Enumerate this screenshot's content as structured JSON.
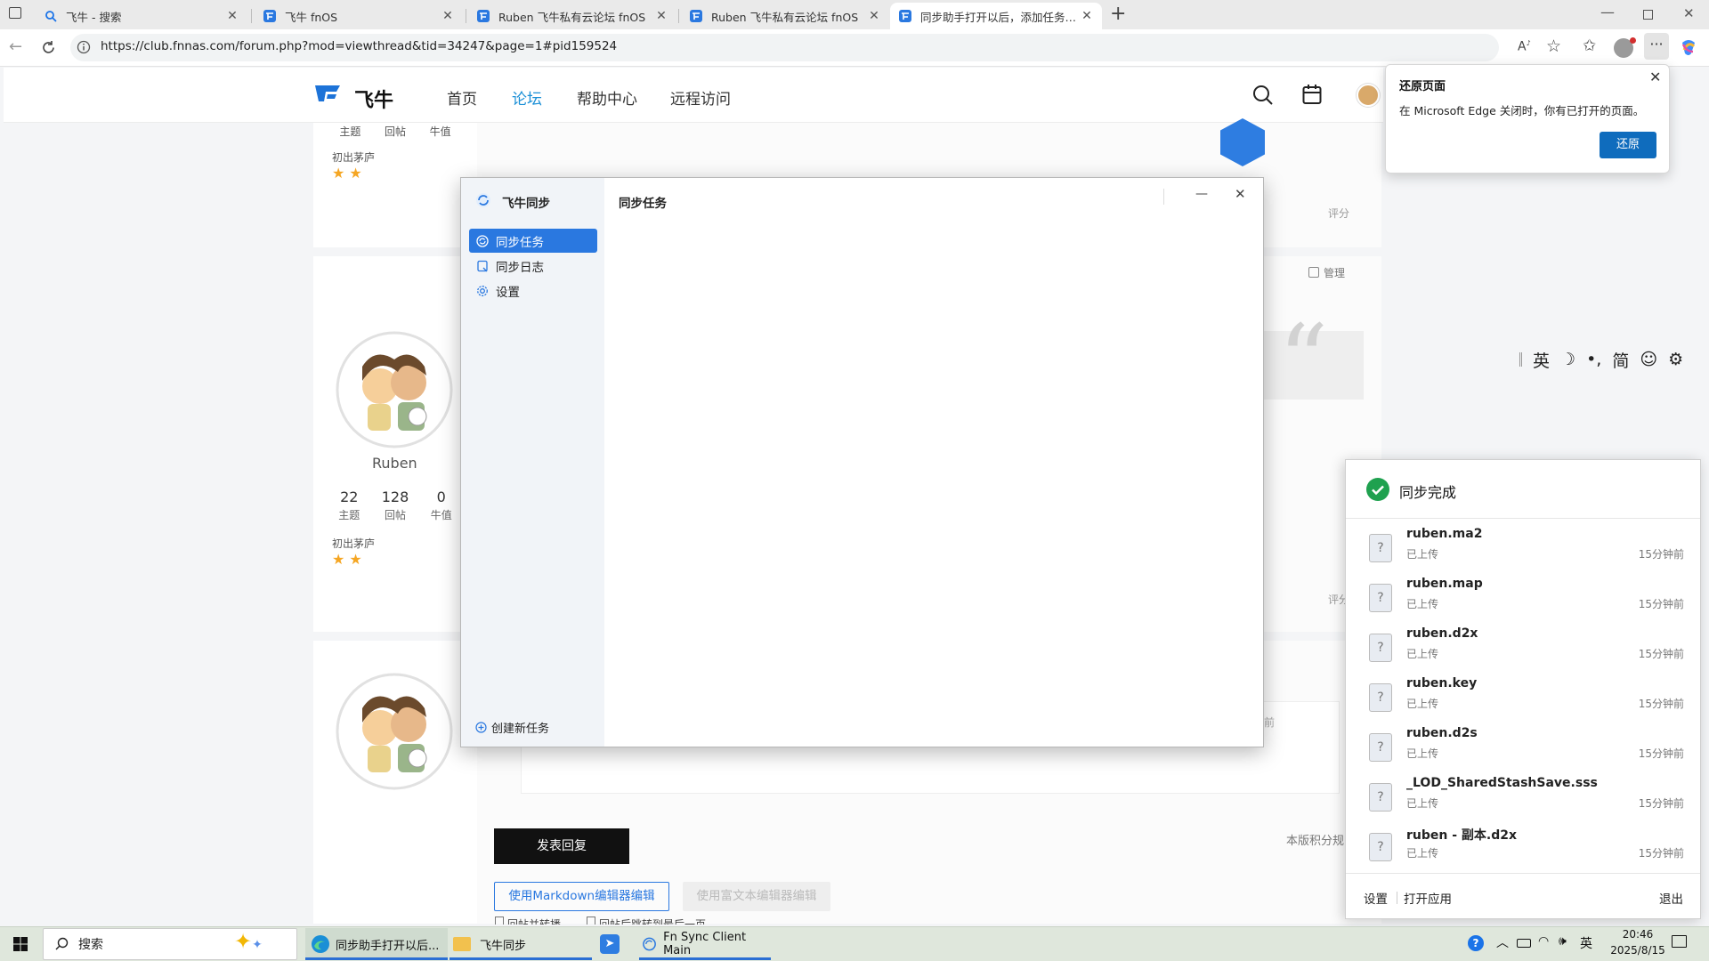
{
  "browser": {
    "tabs": [
      {
        "title": "飞牛 - 搜索"
      },
      {
        "title": "飞牛 fnOS"
      },
      {
        "title": "Ruben 飞牛私有云论坛 fnOS"
      },
      {
        "title": "Ruben 飞牛私有云论坛 fnOS"
      },
      {
        "title": "同步助手打开以后，添加任务程序"
      }
    ],
    "url": "https://club.fnnas.com/forum.php?mod=viewthread&tid=34247&page=1#pid159524"
  },
  "site": {
    "logo_text": "飞牛",
    "nav": [
      "首页",
      "论坛",
      "帮助中心",
      "远程访问"
    ],
    "active_nav": "论坛"
  },
  "forum": {
    "top_stats_labels": [
      "主题",
      "回帖",
      "牛值"
    ],
    "rank": "初出茅庐",
    "user": {
      "name": "Ruben",
      "stats": [
        {
          "value": "22",
          "label": "主题"
        },
        {
          "value": "128",
          "label": "回帖"
        },
        {
          "value": "0",
          "label": "牛值"
        }
      ],
      "rank": "初出茅庐",
      "stars": 2
    },
    "rate_label": "评分",
    "manage_label": "管理",
    "rules_link": "本版积分规",
    "ago_fragment": "前",
    "reply_button": "发表回复",
    "markdown_button": "使用Markdown编辑器编辑",
    "richtext_button": "使用富文本编辑器编辑",
    "option_reply_and_bump": "回帖并转播",
    "option_jump_last": "回帖后跳转到最后一页"
  },
  "sync_app": {
    "app_name": "飞牛同步",
    "header_title": "同步任务",
    "menu": [
      {
        "label": "同步任务",
        "active": true
      },
      {
        "label": "同步日志",
        "active": false
      },
      {
        "label": "设置",
        "active": false
      }
    ],
    "create_task": "创建新任务"
  },
  "restore_popup": {
    "title": "还原页面",
    "message": "在 Microsoft Edge 关闭时，你有已打开的页面。",
    "button": "还原"
  },
  "ime_bar": {
    "items": [
      "英",
      "简"
    ]
  },
  "sync_toast": {
    "title": "同步完成",
    "files": [
      {
        "name": "ruben.ma2",
        "status": "已上传",
        "time": "15分钟前"
      },
      {
        "name": "ruben.map",
        "status": "已上传",
        "time": "15分钟前"
      },
      {
        "name": "ruben.d2x",
        "status": "已上传",
        "time": "15分钟前"
      },
      {
        "name": "ruben.key",
        "status": "已上传",
        "time": "15分钟前"
      },
      {
        "name": "ruben.d2s",
        "status": "已上传",
        "time": "15分钟前"
      },
      {
        "name": "_LOD_SharedStashSave.sss",
        "status": "已上传",
        "time": "15分钟前"
      },
      {
        "name": "ruben - 副本.d2x",
        "status": "已上传",
        "time": "15分钟前"
      }
    ],
    "footer": {
      "settings": "设置",
      "open_app": "打开应用",
      "quit": "退出"
    }
  },
  "taskbar": {
    "search_placeholder": "搜索",
    "apps": [
      {
        "label": "同步助手打开以后..."
      },
      {
        "label": "飞牛同步"
      },
      {
        "label": "Fn Sync Client Main"
      }
    ],
    "lang": "英",
    "time": "20:46",
    "date": "2025/8/15"
  },
  "colors": {
    "accent": "#2a78e0",
    "edge_button": "#0f6cbd",
    "success": "#1fa14f",
    "reply_button": "#111111",
    "nav_active": "#1a8fd6"
  }
}
